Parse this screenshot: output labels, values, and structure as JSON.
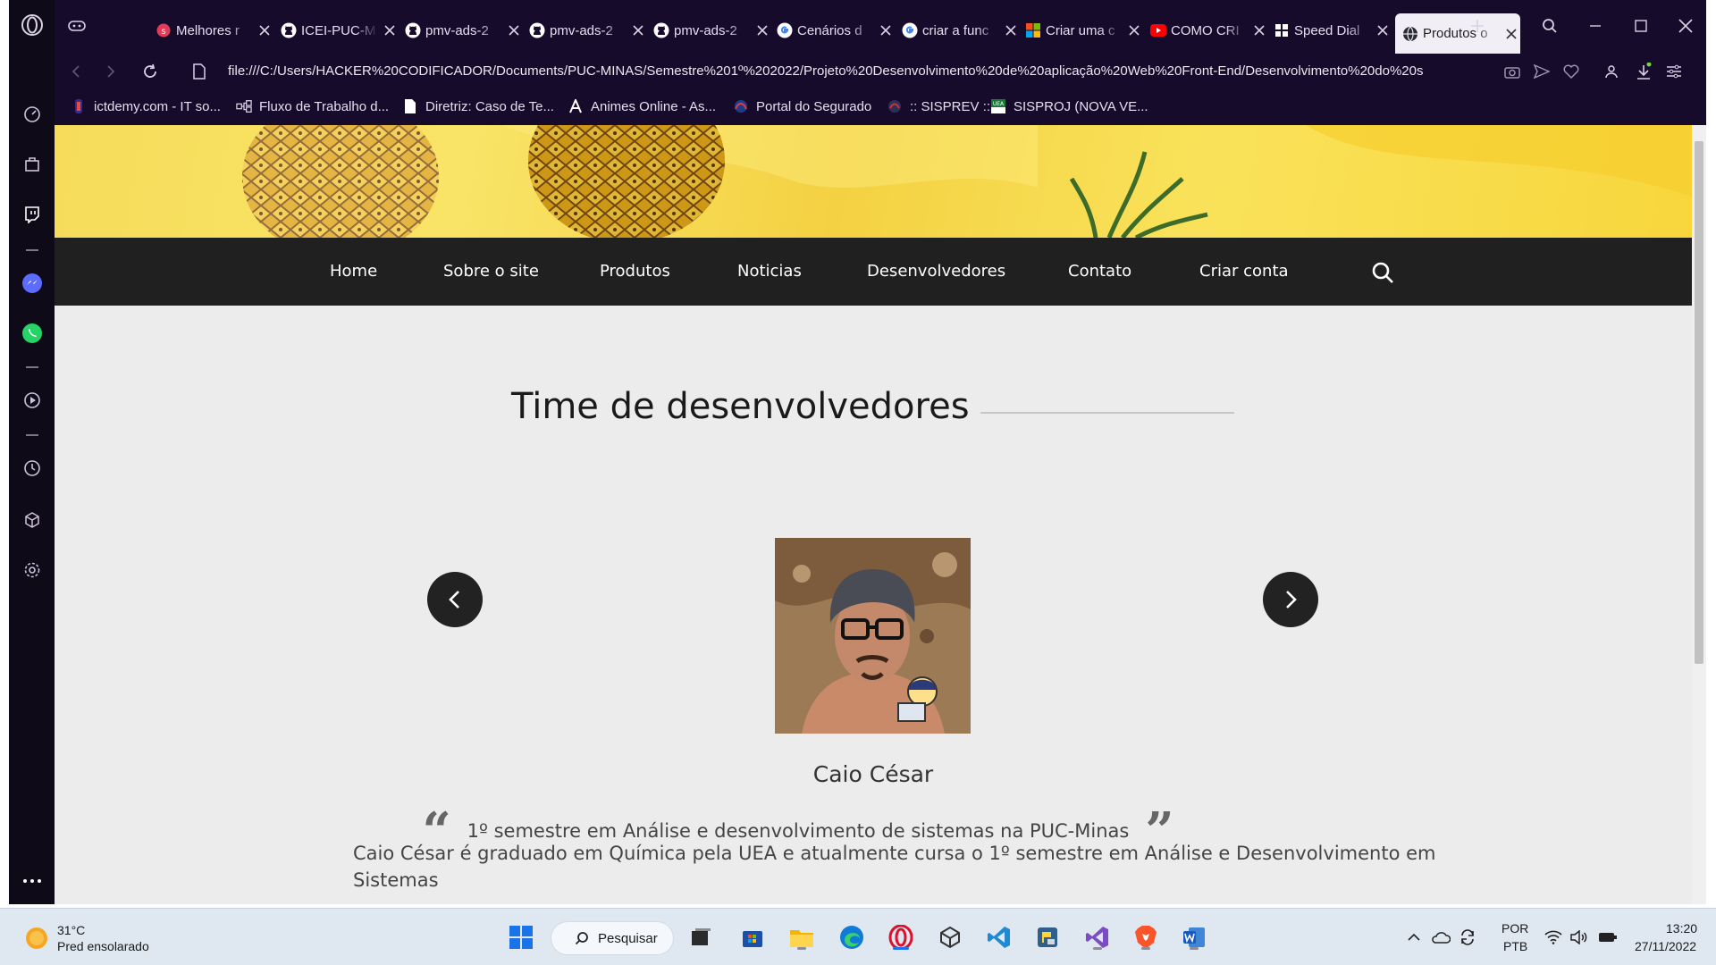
{
  "browser": {
    "tabs": [
      {
        "label": "Melhores r",
        "icon": "s-red-icon"
      },
      {
        "label": "ICEI-PUC-M",
        "icon": "github-icon"
      },
      {
        "label": "pmv-ads-2",
        "icon": "github-icon"
      },
      {
        "label": "pmv-ads-2",
        "icon": "github-icon"
      },
      {
        "label": "pmv-ads-2",
        "icon": "github-icon"
      },
      {
        "label": "Cenários d",
        "icon": "google-icon"
      },
      {
        "label": "criar a func",
        "icon": "google-icon"
      },
      {
        "label": "Criar uma c",
        "icon": "microsoft-icon"
      },
      {
        "label": "COMO CRI",
        "icon": "youtube-icon"
      },
      {
        "label": "Speed Dial",
        "icon": "speed-dial-icon"
      },
      {
        "label": "Produtos o",
        "icon": "globe-icon",
        "active": true
      }
    ],
    "url": "file:///C:/Users/HACKER%20CODIFICADOR/Documents/PUC-MINAS/Semestre%201º%202022/Projeto%20Desenvolvimento%20de%20aplicação%20Web%20Front-End/Desenvolvimento%20do%20s",
    "bookmarks": [
      {
        "label": "ictdemy.com - IT so...",
        "icon": "ictdemy-icon"
      },
      {
        "label": "Fluxo de Trabalho d...",
        "icon": "workflow-icon"
      },
      {
        "label": "Diretriz: Caso de Te...",
        "icon": "page-icon"
      },
      {
        "label": "Animes Online - As...",
        "icon": "letter-a-icon"
      },
      {
        "label": "Portal do Segurado",
        "icon": "portal-icon"
      },
      {
        "label": ":: SISPREV ::",
        "icon": "sisprev-icon"
      },
      {
        "label": "SISPROJ (NOVA VE...",
        "icon": "uea-icon"
      }
    ]
  },
  "site": {
    "nav": [
      "Home",
      "Sobre o site",
      "Produtos",
      "Noticias",
      "Desenvolvedores",
      "Contato",
      "Criar conta"
    ],
    "section_title": "Time de desenvolvedores",
    "developer": {
      "name": "Caio César",
      "quote": "1º semestre em Análise e desenvolvimento de sistemas na PUC-Minas",
      "description": "Caio César é graduado em Química pela UEA e atualmente cursa o 1º semestre em Análise e Desenvolvimento em Sistemas"
    }
  },
  "taskbar": {
    "weather_temp": "31°C",
    "weather_desc": "Pred ensolarado",
    "search_label": "Pesquisar",
    "lang_top": "POR",
    "lang_bottom": "PTB",
    "time": "13:20",
    "date": "27/11/2022"
  },
  "colors": {
    "chrome_bg": "#170b2c",
    "sidebar_bg": "#0f0a17",
    "navbar_bg": "#202020",
    "page_bg": "#ececec",
    "hero_yellow": "#f6dc5a"
  }
}
